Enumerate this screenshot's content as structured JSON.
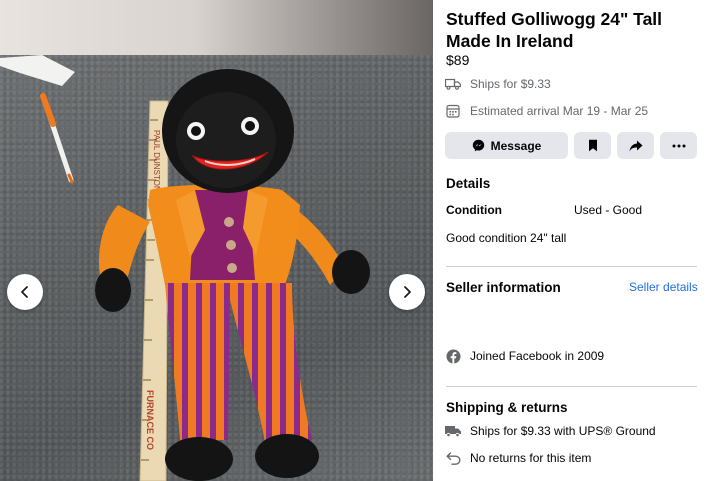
{
  "listing": {
    "title": "Stuffed Golliwogg 24\" Tall Made In Ireland",
    "price": "$89",
    "ships_for": "Ships for $9.33",
    "estimated_arrival": "Estimated arrival Mar 19 - Mar 25"
  },
  "actions": {
    "message_label": "Message"
  },
  "details": {
    "heading": "Details",
    "condition_label": "Condition",
    "condition_value": "Used - Good",
    "description": "Good condition 24\" tall"
  },
  "seller": {
    "heading": "Seller information",
    "details_link": "Seller details",
    "joined": "Joined Facebook in 2009"
  },
  "shipping": {
    "heading": "Shipping & returns",
    "method": "Ships for $9.33 with UPS® Ground",
    "returns": "No returns for this item"
  },
  "ruler_text": {
    "left": "PAUL DUNSTON",
    "bottom": "FURNACE CO"
  },
  "colors": {
    "link": "#216fdb",
    "button_bg": "#e4e6eb",
    "divider": "#ced0d4"
  },
  "icons": [
    "truck-icon",
    "calendar-icon",
    "messenger-icon",
    "bookmark-icon",
    "share-icon",
    "more-icon",
    "facebook-icon",
    "return-icon",
    "chevron-left-icon",
    "chevron-right-icon"
  ]
}
